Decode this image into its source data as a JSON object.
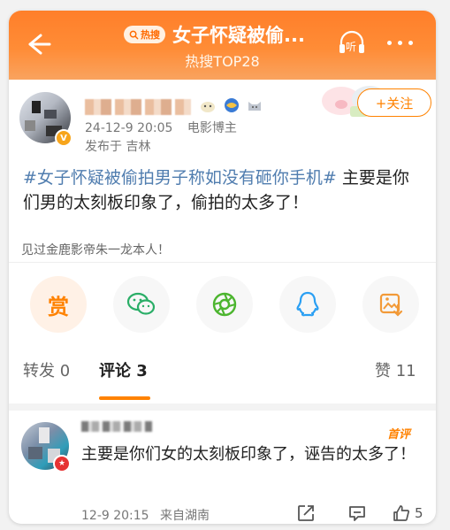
{
  "header": {
    "hot_badge": "热搜",
    "title": "女子怀疑被偷...",
    "subtitle": "热搜TOP28",
    "listen_label": "听"
  },
  "post": {
    "time": "24-12-9 20:05",
    "author_tag": "电影博主",
    "location": "发布于 吉林",
    "follow_label": "+关注",
    "topic": "#女子怀疑被偷拍男子称如没有砸你手机#",
    "body": " 主要是你们男的太刻板印象了，偷拍的太多了！",
    "reward_note": "见过金鹿影帝朱一龙本人！"
  },
  "share": {
    "reward_label": "赏",
    "items": [
      "reward",
      "wechat-icon",
      "moments-icon",
      "qq-icon",
      "save-image-icon"
    ]
  },
  "tabs": [
    {
      "label": "转发",
      "count": "0"
    },
    {
      "label": "评论",
      "count": "3"
    },
    {
      "label": "赞",
      "count": "11"
    }
  ],
  "comment": {
    "first_badge": "首评",
    "text": "主要是你们女的太刻板印象了，诬告的太多了！",
    "time": "12-9 20:15",
    "location": "来自湖南",
    "likes": "5"
  },
  "colors": {
    "accent": "#ff8200",
    "header": "#ff7f2a",
    "topic": "#507daf"
  }
}
